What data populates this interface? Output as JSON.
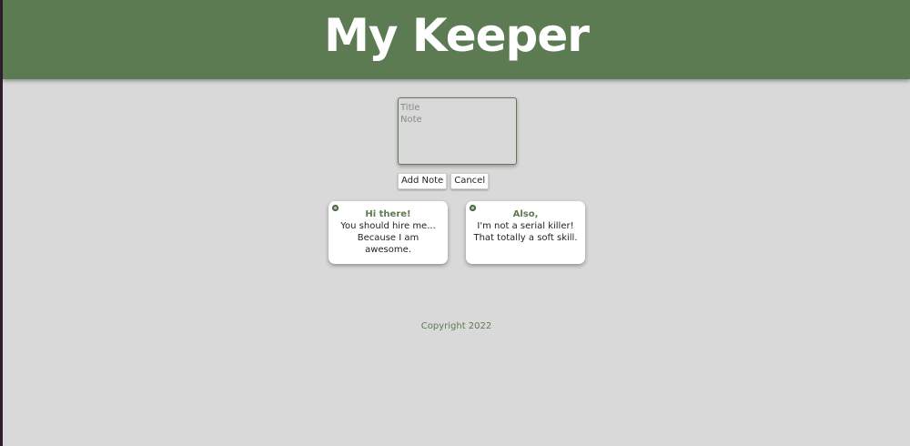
{
  "header": {
    "title": "My Keeper"
  },
  "compose": {
    "title_placeholder": "Title",
    "note_placeholder": "Note",
    "add_label": "Add Note",
    "cancel_label": "Cancel"
  },
  "notes": [
    {
      "title": "Hi there!",
      "content": "You should hire me... Because I am awesome."
    },
    {
      "title": "Also,",
      "content": "I'm not a serial killer! That totally a soft skill."
    }
  ],
  "footer": {
    "text": "Copyright 2022"
  },
  "colors": {
    "accent": "#5c7b53",
    "background": "#dad9d9",
    "card": "#ffffff"
  }
}
